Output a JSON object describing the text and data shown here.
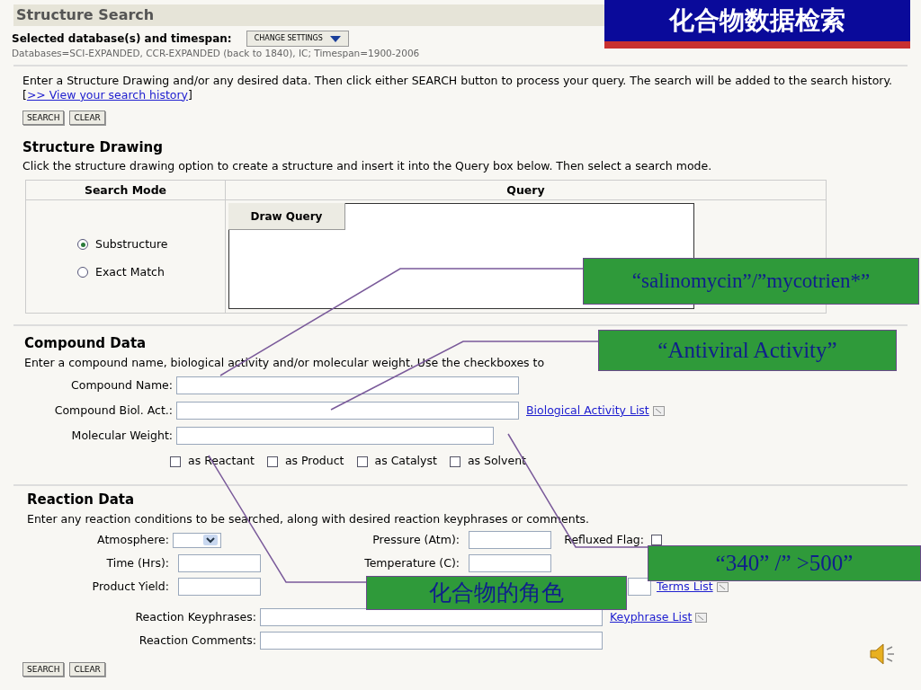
{
  "slide_title": "化合物数据检索",
  "header": {
    "title": "Structure Search",
    "db_label": "Selected database(s) and timespan:",
    "change_button": "CHANGE SETTINGS",
    "db_info": "Databases=SCI-EXPANDED, CCR-EXPANDED (back to 1840), IC; Timespan=1900-2006"
  },
  "intro": {
    "text": "Enter a Structure Drawing and/or any desired data. Then click either SEARCH button to process your query. The search will be added to the search history. [",
    "link": ">> View your search history",
    "tail": "]"
  },
  "top_buttons": [
    "SEARCH",
    "CLEAR"
  ],
  "structure": {
    "title": "Structure Drawing",
    "desc": "Click the structure drawing option to create a structure and insert it into the Query box below. Then select a search mode.",
    "mode_header": "Search Mode",
    "query_header": "Query",
    "draw_button": "Draw Query",
    "modes": [
      {
        "label": "Substructure",
        "selected": true
      },
      {
        "label": "Exact Match",
        "selected": false
      }
    ]
  },
  "compound": {
    "title": "Compound Data",
    "desc": "Enter a compound name, biological activity and/or molecular weight. Use the checkboxes to",
    "fields": [
      {
        "label": "Compound Name:"
      },
      {
        "label": "Compound Biol. Act.:",
        "link": "Biological Activity List"
      },
      {
        "label": "Molecular Weight:"
      }
    ],
    "roles": [
      {
        "label": "as Reactant",
        "checked": false
      },
      {
        "label": "as Product",
        "checked": false
      },
      {
        "label": "as Catalyst",
        "checked": false
      },
      {
        "label": "as Solvent",
        "checked": false
      }
    ]
  },
  "reaction": {
    "title": "Reaction Data",
    "desc": "Enter any reaction conditions to be searched, along with desired reaction keyphrases or comments.",
    "rows": [
      [
        {
          "kind": "select",
          "label": "Atmosphere:"
        },
        {
          "kind": "input",
          "label": "Pressure (Atm):"
        },
        {
          "kind": "checkbox",
          "label": "Refluxed Flag:",
          "checked": false
        }
      ],
      [
        {
          "kind": "input",
          "label": "Time (Hrs):"
        },
        {
          "kind": "input",
          "label": "Temperature (C):"
        },
        {
          "kind": "none"
        }
      ],
      [
        {
          "kind": "input",
          "label": "Product Yield:"
        },
        {
          "kind": "none"
        },
        {
          "kind": "input",
          "link": "Terms List"
        }
      ]
    ],
    "wide_fields": [
      {
        "label": "Reaction Keyphrases:",
        "link": "Keyphrase List"
      },
      {
        "label": "Reaction Comments:"
      }
    ]
  },
  "bottom_buttons": [
    "SEARCH",
    "CLEAR"
  ],
  "callouts": [
    {
      "text": "“salinomycin”/”mycotrien*”"
    },
    {
      "text": "“Antiviral Activity”"
    },
    {
      "text": "“340” /” >500”"
    },
    {
      "text": "化合物的角色"
    }
  ]
}
